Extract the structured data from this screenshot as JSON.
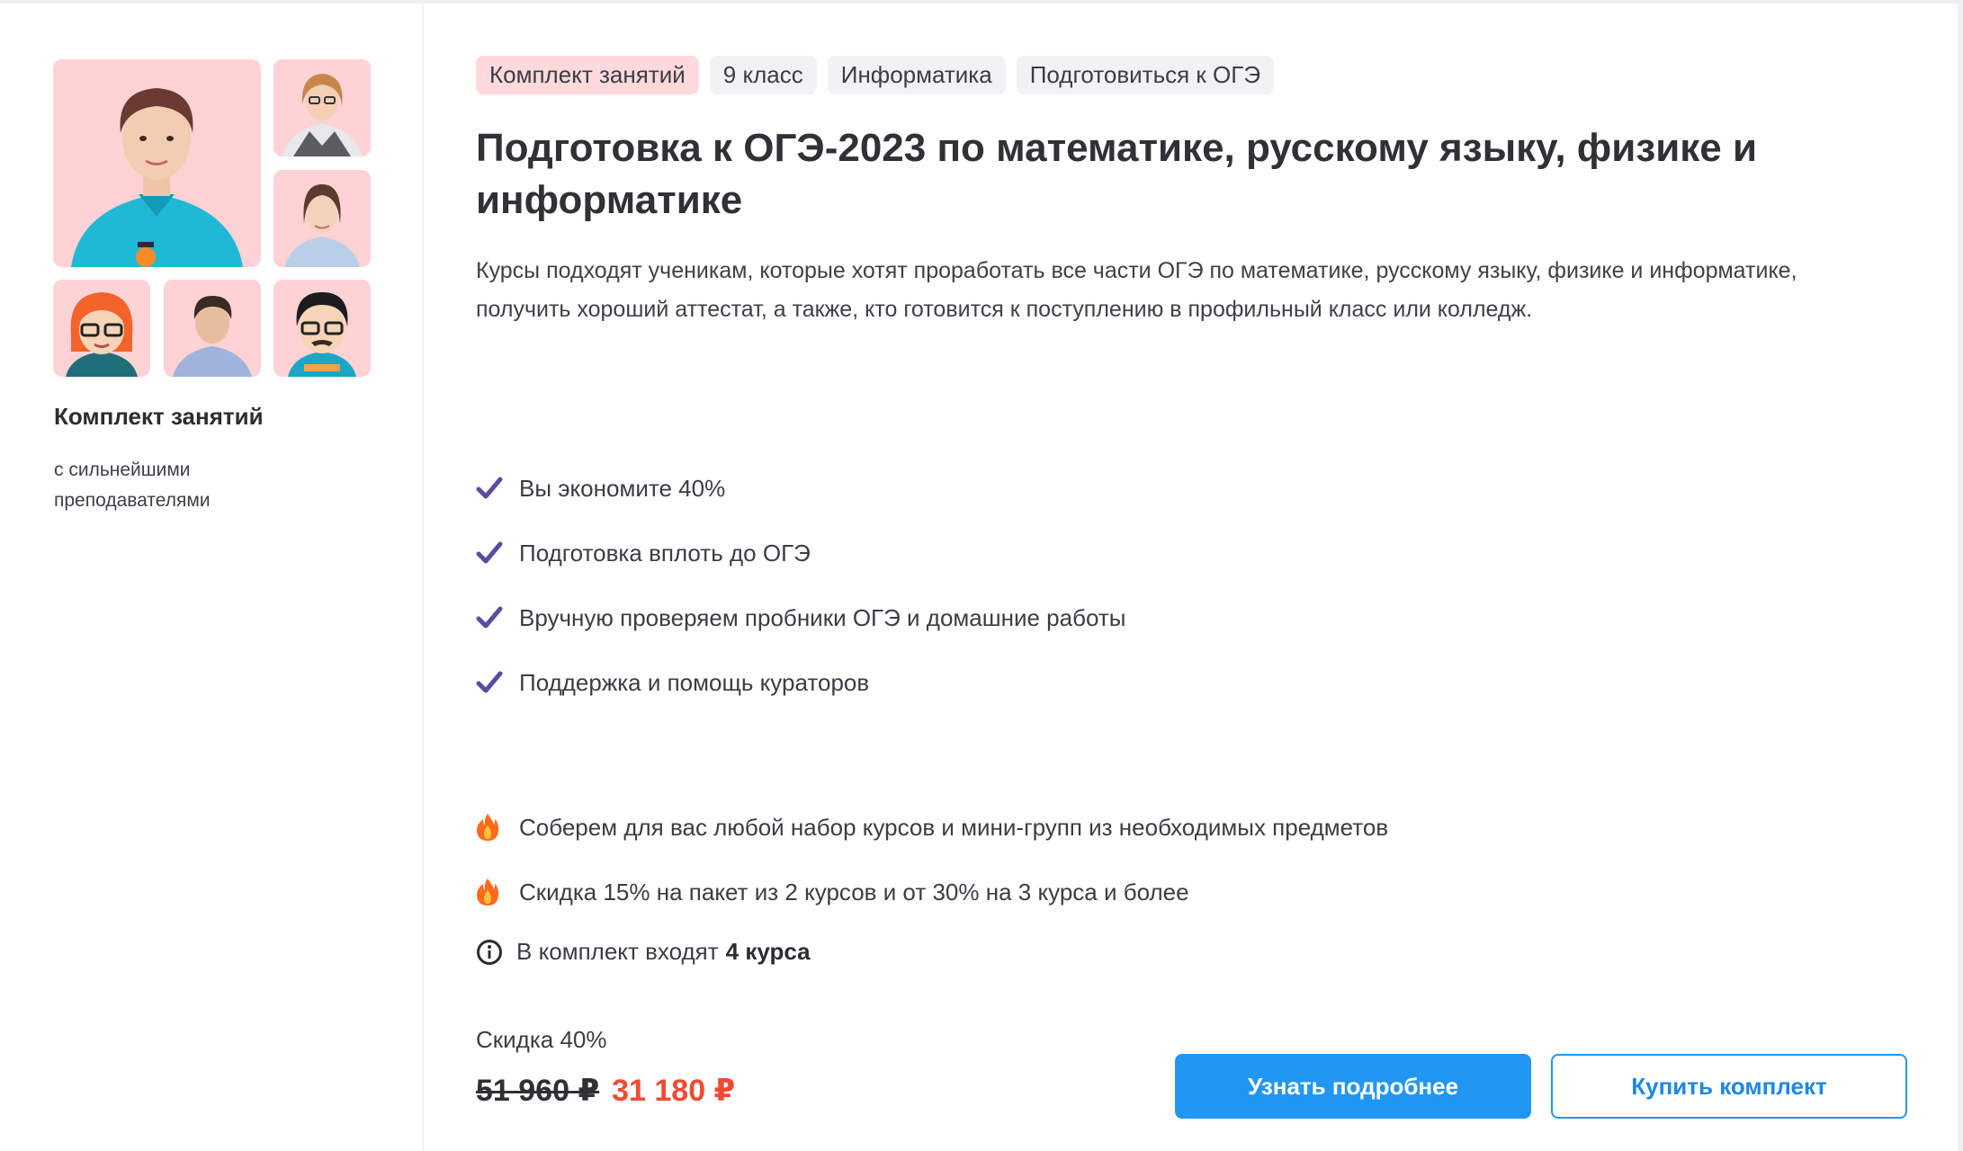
{
  "tags": [
    "Комплект занятий",
    "9 класс",
    "Информатика",
    "Подготовиться к ОГЭ"
  ],
  "title": "Подготовка к ОГЭ-2023 по математике, русскому языку, физике и информатике",
  "description": "Курсы подходят ученикам, которые хотят проработать все части ОГЭ по математике, русскому языку, физике и информатике, получить хороший аттестат, а также, кто готовится к поступлению в профильный класс или колледж.",
  "left_panel": {
    "title": "Комплект занятий",
    "subtitle": "с сильнейшими преподавателями"
  },
  "benefits": [
    {
      "icon": "check-icon",
      "text": "Вы экономите 40%"
    },
    {
      "icon": "check-icon",
      "text": "Подготовка вплоть до ОГЭ"
    },
    {
      "icon": "check-icon",
      "text": "Вручную проверяем пробники ОГЭ и домашние работы"
    },
    {
      "icon": "check-icon",
      "text": "Поддержка и помощь кураторов"
    }
  ],
  "offers": [
    {
      "icon": "fire-icon",
      "text": "Соберем для вас любой набор курсов и мини-групп из необходимых предметов"
    },
    {
      "icon": "fire-icon",
      "text": "Скидка 15% на пакет из 2 курсов и от 30% на 3 курса и более"
    }
  ],
  "info": {
    "icon": "info-icon",
    "text": "В комплект входят",
    "count": "4 курса"
  },
  "pricing": {
    "discount_label": "Скидка 40%",
    "old_price": "51 960 ₽",
    "new_price": "31 180 ₽"
  },
  "buttons": {
    "details": "Узнать подробнее",
    "buy": "Купить комплект"
  },
  "colors": {
    "accent_blue": "#2196f3",
    "price_red": "#f04b32",
    "check_purple": "#5d4aa0",
    "tag_pink": "#ffd9dc",
    "photo_bg": "#ffd2d5"
  }
}
